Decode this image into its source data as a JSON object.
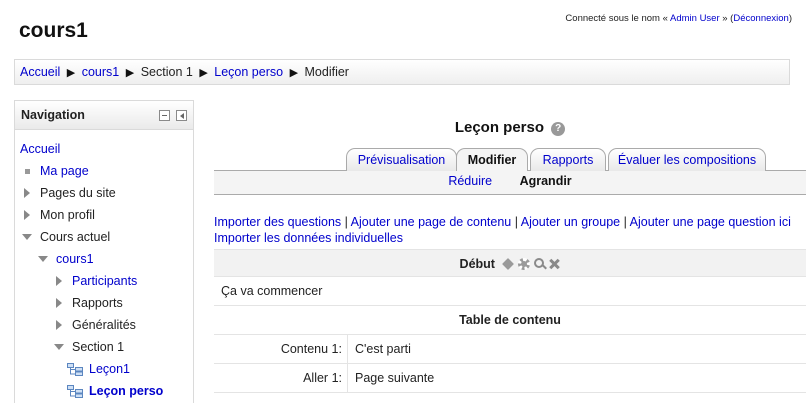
{
  "header": {
    "site_title": "cours1",
    "login_prefix": "Connecté sous le nom « ",
    "login_user": "Admin User",
    "login_mid": " » (",
    "logout": "Déconnexion",
    "login_suffix": ")"
  },
  "breadcrumb": {
    "items": [
      "Accueil",
      "cours1",
      "Section 1",
      "Leçon perso",
      "Modifier"
    ],
    "separator": "▶"
  },
  "navigation": {
    "title": "Navigation",
    "items": [
      {
        "label": "Accueil"
      },
      {
        "label": "Ma page"
      },
      {
        "label": "Pages du site"
      },
      {
        "label": "Mon profil"
      },
      {
        "label": "Cours actuel"
      },
      {
        "label": "cours1"
      },
      {
        "label": "Participants"
      },
      {
        "label": "Rapports"
      },
      {
        "label": "Généralités"
      },
      {
        "label": "Section 1"
      },
      {
        "label": "Leçon1"
      },
      {
        "label": "Leçon perso"
      }
    ]
  },
  "lesson": {
    "title": "Leçon perso",
    "help": "?"
  },
  "tabs": {
    "items": [
      "Prévisualisation",
      "Modifier",
      "Rapports",
      "Évaluer les compositions"
    ],
    "active": "Modifier"
  },
  "subtabs": {
    "collapse": "Réduire",
    "expand": "Agrandir"
  },
  "actions": {
    "import_questions": "Importer des questions",
    "add_content_page": "Ajouter une page de contenu",
    "add_group": "Ajouter un groupe",
    "add_question_page": "Ajouter une page question ici",
    "import_individual": "Importer les données individuelles",
    "sep": " | "
  },
  "page": {
    "title": "Début",
    "contents": "Ça va commencer",
    "table_header": "Table de contenu",
    "rows": [
      {
        "label": "Contenu 1:",
        "value": "C'est parti"
      },
      {
        "label": "Aller 1:",
        "value": "Page suivante"
      }
    ]
  },
  "colors": {
    "link": "#0000cc",
    "accent_gray": "#f4f4f4",
    "border": "#aaaaaa"
  }
}
